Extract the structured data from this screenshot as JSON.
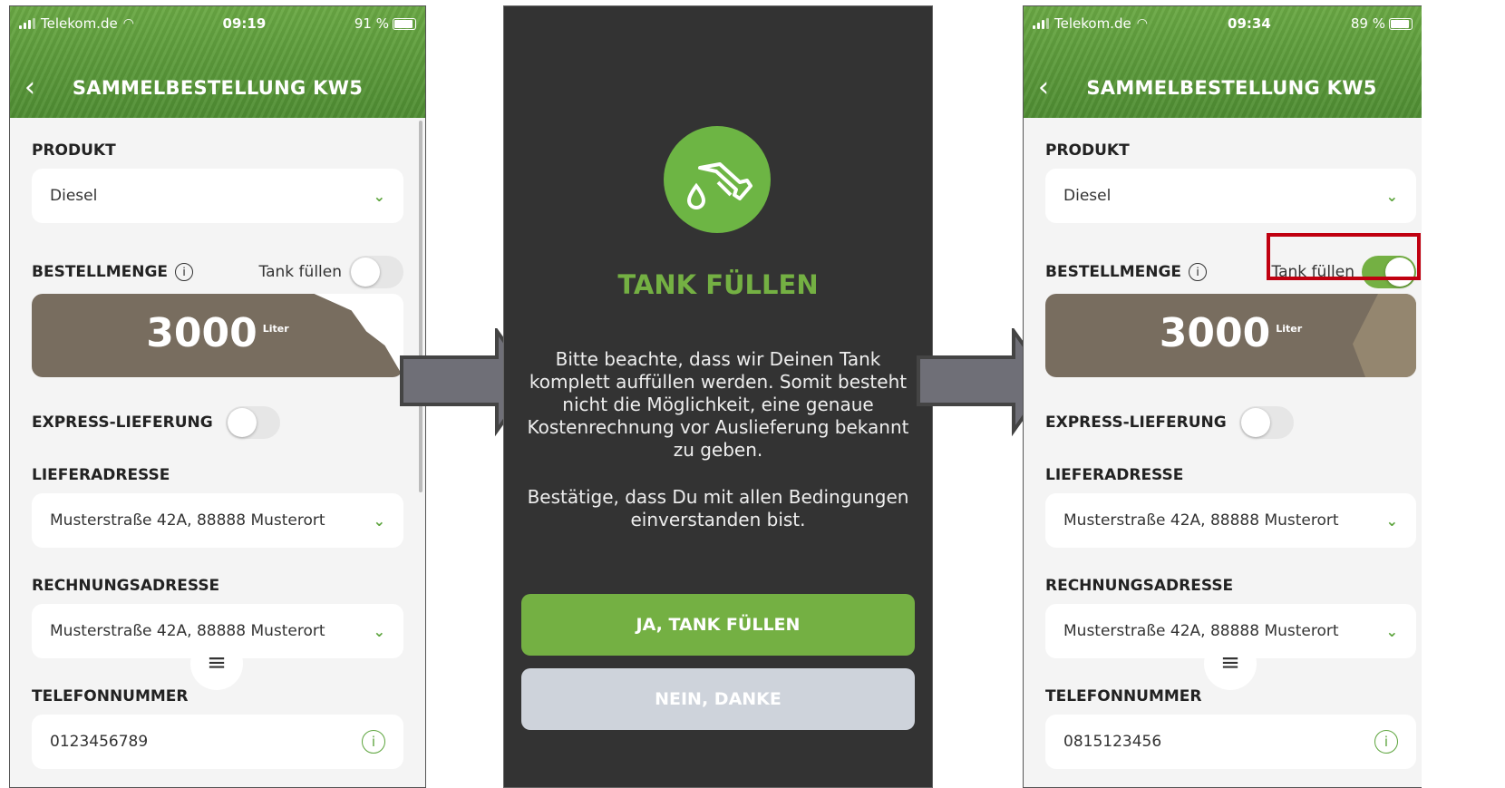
{
  "left": {
    "status": {
      "carrier": "Telekom.de",
      "time": "09:19",
      "battery": "91 %"
    },
    "title": "SAMMELBESTELLUNG KW5",
    "produkt_label": "PRODUKT",
    "produkt_value": "Diesel",
    "bestellmenge_label": "BESTELLMENGE",
    "tank_label": "Tank füllen",
    "tank_on": false,
    "amount": "3000",
    "unit": "Liter",
    "express_label": "EXPRESS-LIEFERUNG",
    "liefer_label": "LIEFERADRESSE",
    "liefer_value": "Musterstraße 42A, 88888 Musterort",
    "rechnung_label": "RECHNUNGSADRESSE",
    "rechnung_value": "Musterstraße 42A, 88888 Musterort",
    "telefon_label": "TELEFONNUMMER",
    "telefon_value": "0123456789"
  },
  "dialog": {
    "title": "TANK FÜLLEN",
    "text1": "Bitte beachte, dass wir Deinen Tank komplett auffüllen werden. Somit besteht nicht die Möglichkeit, eine genaue Kostenrechnung vor Auslieferung bekannt zu geben.",
    "text2": "Bestätige, dass Du mit allen Bedingungen einverstanden bist.",
    "yes_button": "JA, TANK FÜLLEN",
    "no_button": "NEIN, DANKE"
  },
  "right": {
    "status": {
      "carrier": "Telekom.de",
      "time": "09:34",
      "battery": "89 %"
    },
    "title": "SAMMELBESTELLUNG KW5",
    "produkt_label": "PRODUKT",
    "produkt_value": "Diesel",
    "bestellmenge_label": "BESTELLMENGE",
    "tank_label": "Tank füllen",
    "tank_on": true,
    "amount": "3000",
    "unit": "Liter",
    "express_label": "EXPRESS-LIEFERUNG",
    "liefer_label": "LIEFERADRESSE",
    "liefer_value": "Musterstraße 42A, 88888 Musterort",
    "rechnung_label": "RECHNUNGSADRESSE",
    "rechnung_value": "Musterstraße 42A, 88888 Musterort",
    "telefon_label": "TELEFONNUMMER",
    "telefon_value": "0815123456"
  },
  "colors": {
    "brand_green": "#74b043",
    "highlight_red": "#c00010",
    "dialog_bg": "#333333",
    "quantity_brown": "#786d5f"
  }
}
